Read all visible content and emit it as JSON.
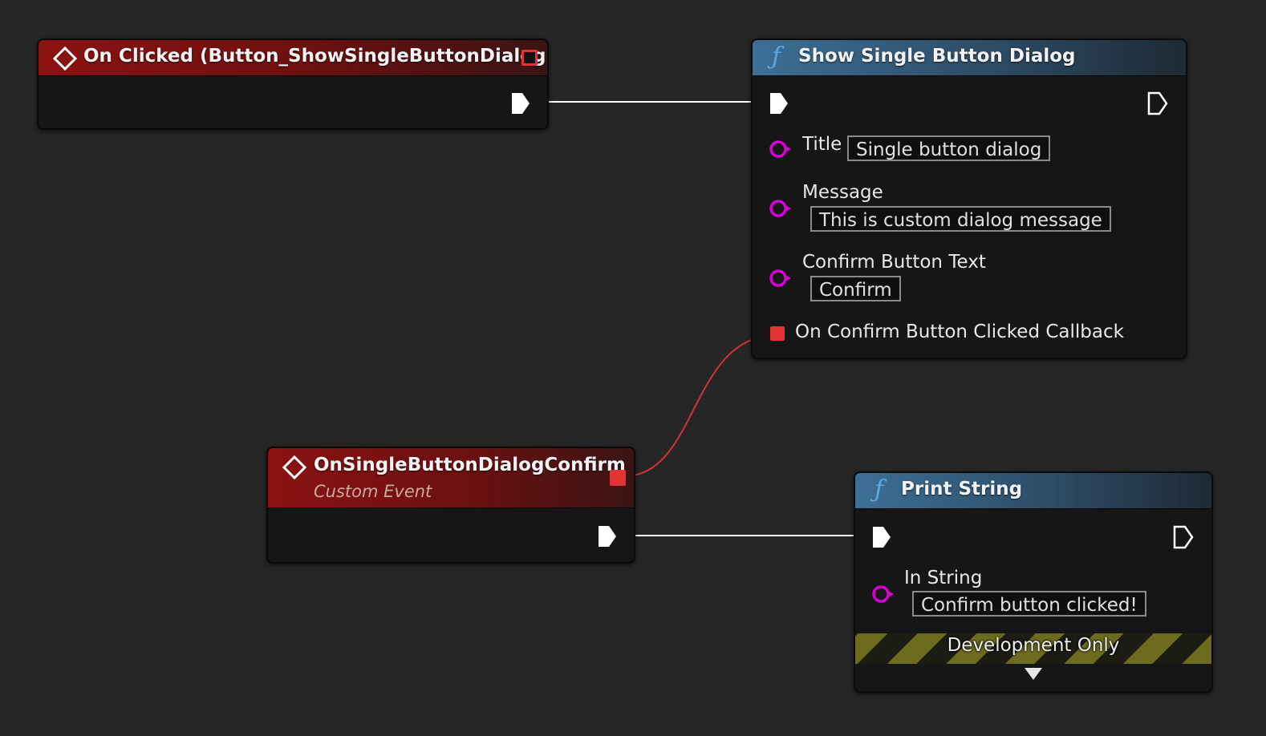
{
  "graph": {
    "background_color": "#262626",
    "exec_wire_color": "#ffffff",
    "delegate_wire_color": "#d23232",
    "pin_colors": {
      "exec": "#ffffff",
      "string": "#d600d6",
      "delegate": "#e23434"
    }
  },
  "nodes": {
    "on_clicked": {
      "title": "On Clicked (Button_ShowSingleButtonDialog)",
      "icon": "event-diamond-icon"
    },
    "show_dialog": {
      "title": "Show Single Button Dialog",
      "icon": "function-f-icon",
      "pins": {
        "title_label": "Title",
        "title_value": "Single button dialog",
        "message_label": "Message",
        "message_value": "This is custom dialog message",
        "confirm_label": "Confirm Button Text",
        "confirm_value": "Confirm",
        "callback_label": "On Confirm Button Clicked Callback"
      }
    },
    "custom_event": {
      "title": "OnSingleButtonDialogConfirm",
      "subtitle": "Custom Event",
      "icon": "event-diamond-icon"
    },
    "print_string": {
      "title": "Print String",
      "icon": "function-f-icon",
      "pins": {
        "in_string_label": "In String",
        "in_string_value": "Confirm button clicked!"
      },
      "dev_label": "Development Only",
      "expand_icon": "expand-triangle-icon"
    }
  }
}
